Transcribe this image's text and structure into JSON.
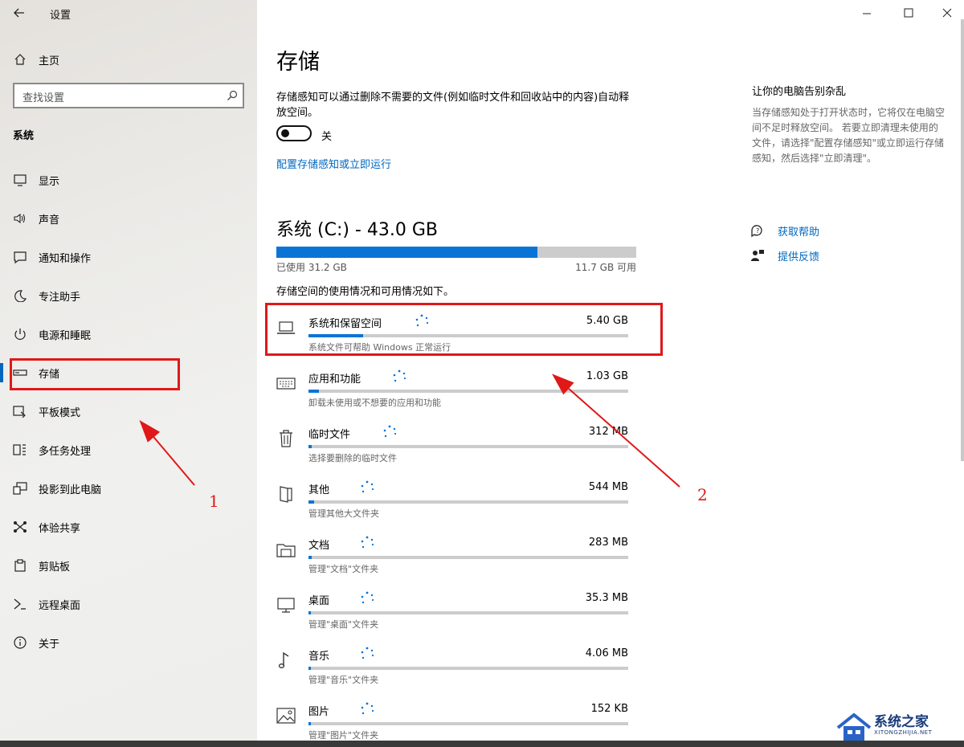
{
  "window": {
    "title": "设置",
    "controls": [
      "minimize-icon",
      "maximize-icon",
      "close-icon"
    ]
  },
  "sidebar": {
    "home_label": "主页",
    "search_placeholder": "查找设置",
    "section_title": "系统",
    "items": [
      {
        "label": "显示",
        "icon": "display-icon"
      },
      {
        "label": "声音",
        "icon": "sound-icon"
      },
      {
        "label": "通知和操作",
        "icon": "notification-icon"
      },
      {
        "label": "专注助手",
        "icon": "moon-icon"
      },
      {
        "label": "电源和睡眠",
        "icon": "power-icon"
      },
      {
        "label": "存储",
        "icon": "storage-icon",
        "active": true
      },
      {
        "label": "平板模式",
        "icon": "tablet-icon"
      },
      {
        "label": "多任务处理",
        "icon": "multitask-icon"
      },
      {
        "label": "投影到此电脑",
        "icon": "project-icon"
      },
      {
        "label": "体验共享",
        "icon": "share-icon"
      },
      {
        "label": "剪贴板",
        "icon": "clipboard-icon"
      },
      {
        "label": "远程桌面",
        "icon": "remote-icon"
      },
      {
        "label": "关于",
        "icon": "info-icon"
      }
    ]
  },
  "main": {
    "title": "存储",
    "description": "存储感知可以通过删除不需要的文件(例如临时文件和回收站中的内容)自动释放空间。",
    "toggle_label": "关",
    "toggle_on": false,
    "config_link": "配置存储感知或立即运行",
    "drive": {
      "title": "系统 (C:) - 43.0 GB",
      "used": "已使用 31.2 GB",
      "free": "11.7 GB 可用",
      "used_fraction": 0.726
    },
    "usage_desc": "存储空间的使用情况和可用情况如下。",
    "categories": [
      {
        "name": "系统和保留空间",
        "size": "5.40 GB",
        "desc": "系统文件可帮助 Windows 正常运行",
        "fraction": 0.17,
        "icon": "laptop-icon"
      },
      {
        "name": "应用和功能",
        "size": "1.03 GB",
        "desc": "卸载未使用或不想要的应用和功能",
        "fraction": 0.033,
        "icon": "keyboard-icon"
      },
      {
        "name": "临时文件",
        "size": "312 MB",
        "desc": "选择要删除的临时文件",
        "fraction": 0.01,
        "icon": "trash-icon"
      },
      {
        "name": "其他",
        "size": "544 MB",
        "desc": "管理其他大文件夹",
        "fraction": 0.017,
        "icon": "other-icon"
      },
      {
        "name": "文档",
        "size": "283 MB",
        "desc": "管理\"文档\"文件夹",
        "fraction": 0.009,
        "icon": "documents-icon"
      },
      {
        "name": "桌面",
        "size": "35.3 MB",
        "desc": "管理\"桌面\"文件夹",
        "fraction": 0.002,
        "icon": "desktop-icon"
      },
      {
        "name": "音乐",
        "size": "4.06 MB",
        "desc": "管理\"音乐\"文件夹",
        "fraction": 0.001,
        "icon": "music-icon"
      },
      {
        "name": "图片",
        "size": "152 KB",
        "desc": "管理\"图片\"文件夹",
        "fraction": 0.001,
        "icon": "picture-icon"
      }
    ]
  },
  "side_panel": {
    "title": "让你的电脑告别杂乱",
    "description": "当存储感知处于打开状态时，它将仅在电脑空间不足时释放空间。 若要立即清理未使用的文件，请选择\"配置存储感知\"或立即运行存储感知，然后选择\"立即清理\"。",
    "help_label": "获取帮助",
    "feedback_label": "提供反馈"
  },
  "annotations": {
    "label_1": "1",
    "label_2": "2",
    "color": "#e01818"
  },
  "watermark": {
    "main": "系统之家",
    "sub": "XITONGZHIJIA.NET"
  },
  "colors": {
    "accent": "#0067c0",
    "bar_fill": "#0a74d6",
    "bar_track": "#cccccc"
  }
}
